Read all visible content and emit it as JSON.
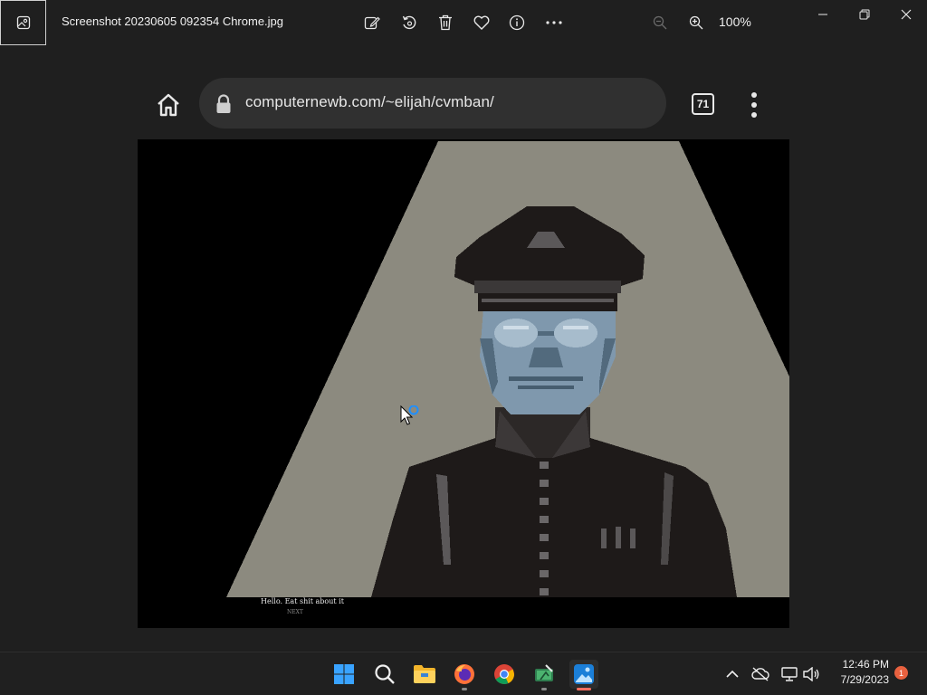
{
  "window": {
    "title": "Screenshot 20230605 092354 Chrome.jpg",
    "zoom": "100%",
    "toolbar_icons": [
      "edit-image-icon",
      "rotate-icon",
      "delete-icon",
      "favorite-icon",
      "info-icon",
      "more-icon"
    ],
    "zoom_out_icon": "zoom-out-icon",
    "zoom_in_icon": "zoom-in-icon"
  },
  "browser": {
    "url": "computernewb.com/~elijah/cvmban/",
    "tab_count": "71"
  },
  "game": {
    "dialog": "Hello. Eat shit about it",
    "next": "NEXT"
  },
  "taskbar": {
    "apps": [
      "start-icon",
      "search-icon",
      "file-explorer-icon",
      "firefox-icon",
      "chrome-icon",
      "photo-editor-icon",
      "photos-icon"
    ],
    "time": "12:46 PM",
    "date": "7/29/2023",
    "notifications": "1"
  },
  "colors": {
    "background": "#1f1f1f",
    "spotlight": "#8c8a7f",
    "uniform": "#1e1a19",
    "face": "#7f98ad",
    "accent": "#0078d4"
  }
}
